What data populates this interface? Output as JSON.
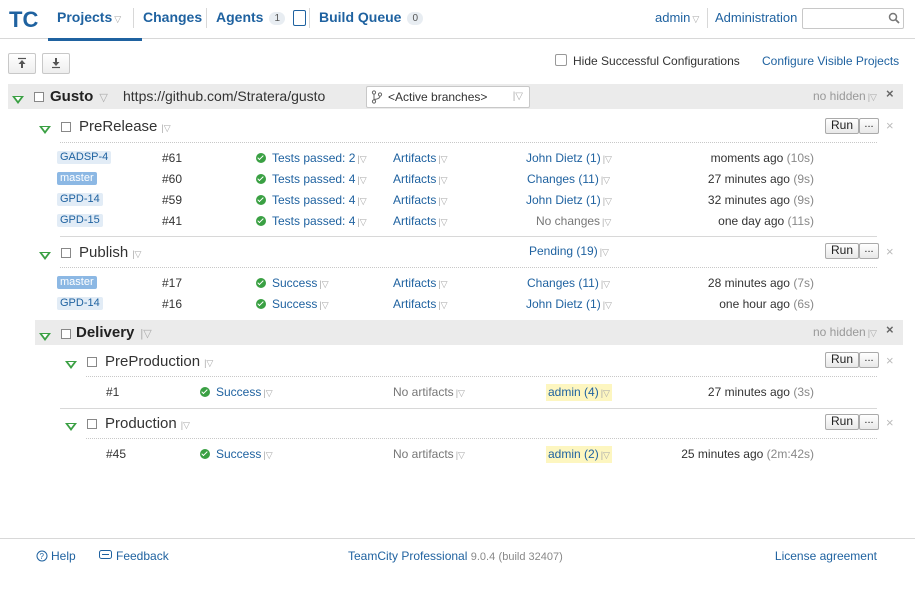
{
  "header": {
    "logo_text": "TC",
    "nav": [
      {
        "label": "Projects"
      },
      {
        "label": "Changes"
      },
      {
        "label": "Agents",
        "count": "1"
      },
      {
        "label": "Build Queue",
        "count": "0"
      }
    ],
    "user": "admin",
    "administration": "Administration",
    "search_placeholder": ""
  },
  "toolbar": {
    "hide_successful_label": "Hide Successful Configurations",
    "configure_visible_label": "Configure Visible Projects"
  },
  "projects": [
    {
      "name": "Gusto",
      "url": "https://github.com/Stratera/gusto",
      "branch_selector": "<Active branches>",
      "no_hidden": "no hidden",
      "configs": [
        {
          "name": "PreRelease",
          "run": "Run",
          "more": "...",
          "builds": [
            {
              "branch": "GADSP-4",
              "number": "#61",
              "status": "Tests passed: 2",
              "artifacts": "Artifacts",
              "changes": "John Dietz (1)",
              "time": "moments ago",
              "duration": "(10s)"
            },
            {
              "branch": "master",
              "number": "#60",
              "status": "Tests passed: 4",
              "artifacts": "Artifacts",
              "changes": "Changes (11)",
              "time": "27 minutes ago",
              "duration": "(9s)"
            },
            {
              "branch": "GPD-14",
              "number": "#59",
              "status": "Tests passed: 4",
              "artifacts": "Artifacts",
              "changes": "John Dietz (1)",
              "time": "32 minutes ago",
              "duration": "(9s)"
            },
            {
              "branch": "GPD-15",
              "number": "#41",
              "status": "Tests passed: 4",
              "artifacts": "Artifacts",
              "changes": "No changes",
              "time": "one day ago",
              "duration": "(11s)"
            }
          ]
        },
        {
          "name": "Publish",
          "pending": "Pending (19)",
          "run": "Run",
          "more": "...",
          "builds": [
            {
              "branch": "master",
              "number": "#17",
              "status": "Success",
              "artifacts": "Artifacts",
              "changes": "Changes (11)",
              "time": "28 minutes ago",
              "duration": "(7s)"
            },
            {
              "branch": "GPD-14",
              "number": "#16",
              "status": "Success",
              "artifacts": "Artifacts",
              "changes": "John Dietz (1)",
              "time": "one hour ago",
              "duration": "(6s)"
            }
          ]
        }
      ]
    },
    {
      "name": "Delivery",
      "no_hidden": "no hidden",
      "configs": [
        {
          "name": "PreProduction",
          "run": "Run",
          "more": "...",
          "builds": [
            {
              "number": "#1",
              "status": "Success",
              "artifacts": "No artifacts",
              "changes": "admin (4)",
              "time": "27 minutes ago",
              "duration": "(3s)"
            }
          ]
        },
        {
          "name": "Production",
          "run": "Run",
          "more": "...",
          "builds": [
            {
              "number": "#45",
              "status": "Success",
              "artifacts": "No artifacts",
              "changes": "admin (2)",
              "time": "25 minutes ago",
              "duration": "(2m:42s)"
            }
          ]
        }
      ]
    }
  ],
  "footer": {
    "help": "Help",
    "feedback": "Feedback",
    "product": "TeamCity Professional",
    "version": "9.0.4",
    "build": "(build 32407)",
    "license": "License agreement"
  },
  "colors": {
    "link": "#1f62a0",
    "success": "#3aa043",
    "branch_bg": "#e2ecf6",
    "master_bg": "#8cb8e4",
    "highlight": "#fdf6c0"
  }
}
